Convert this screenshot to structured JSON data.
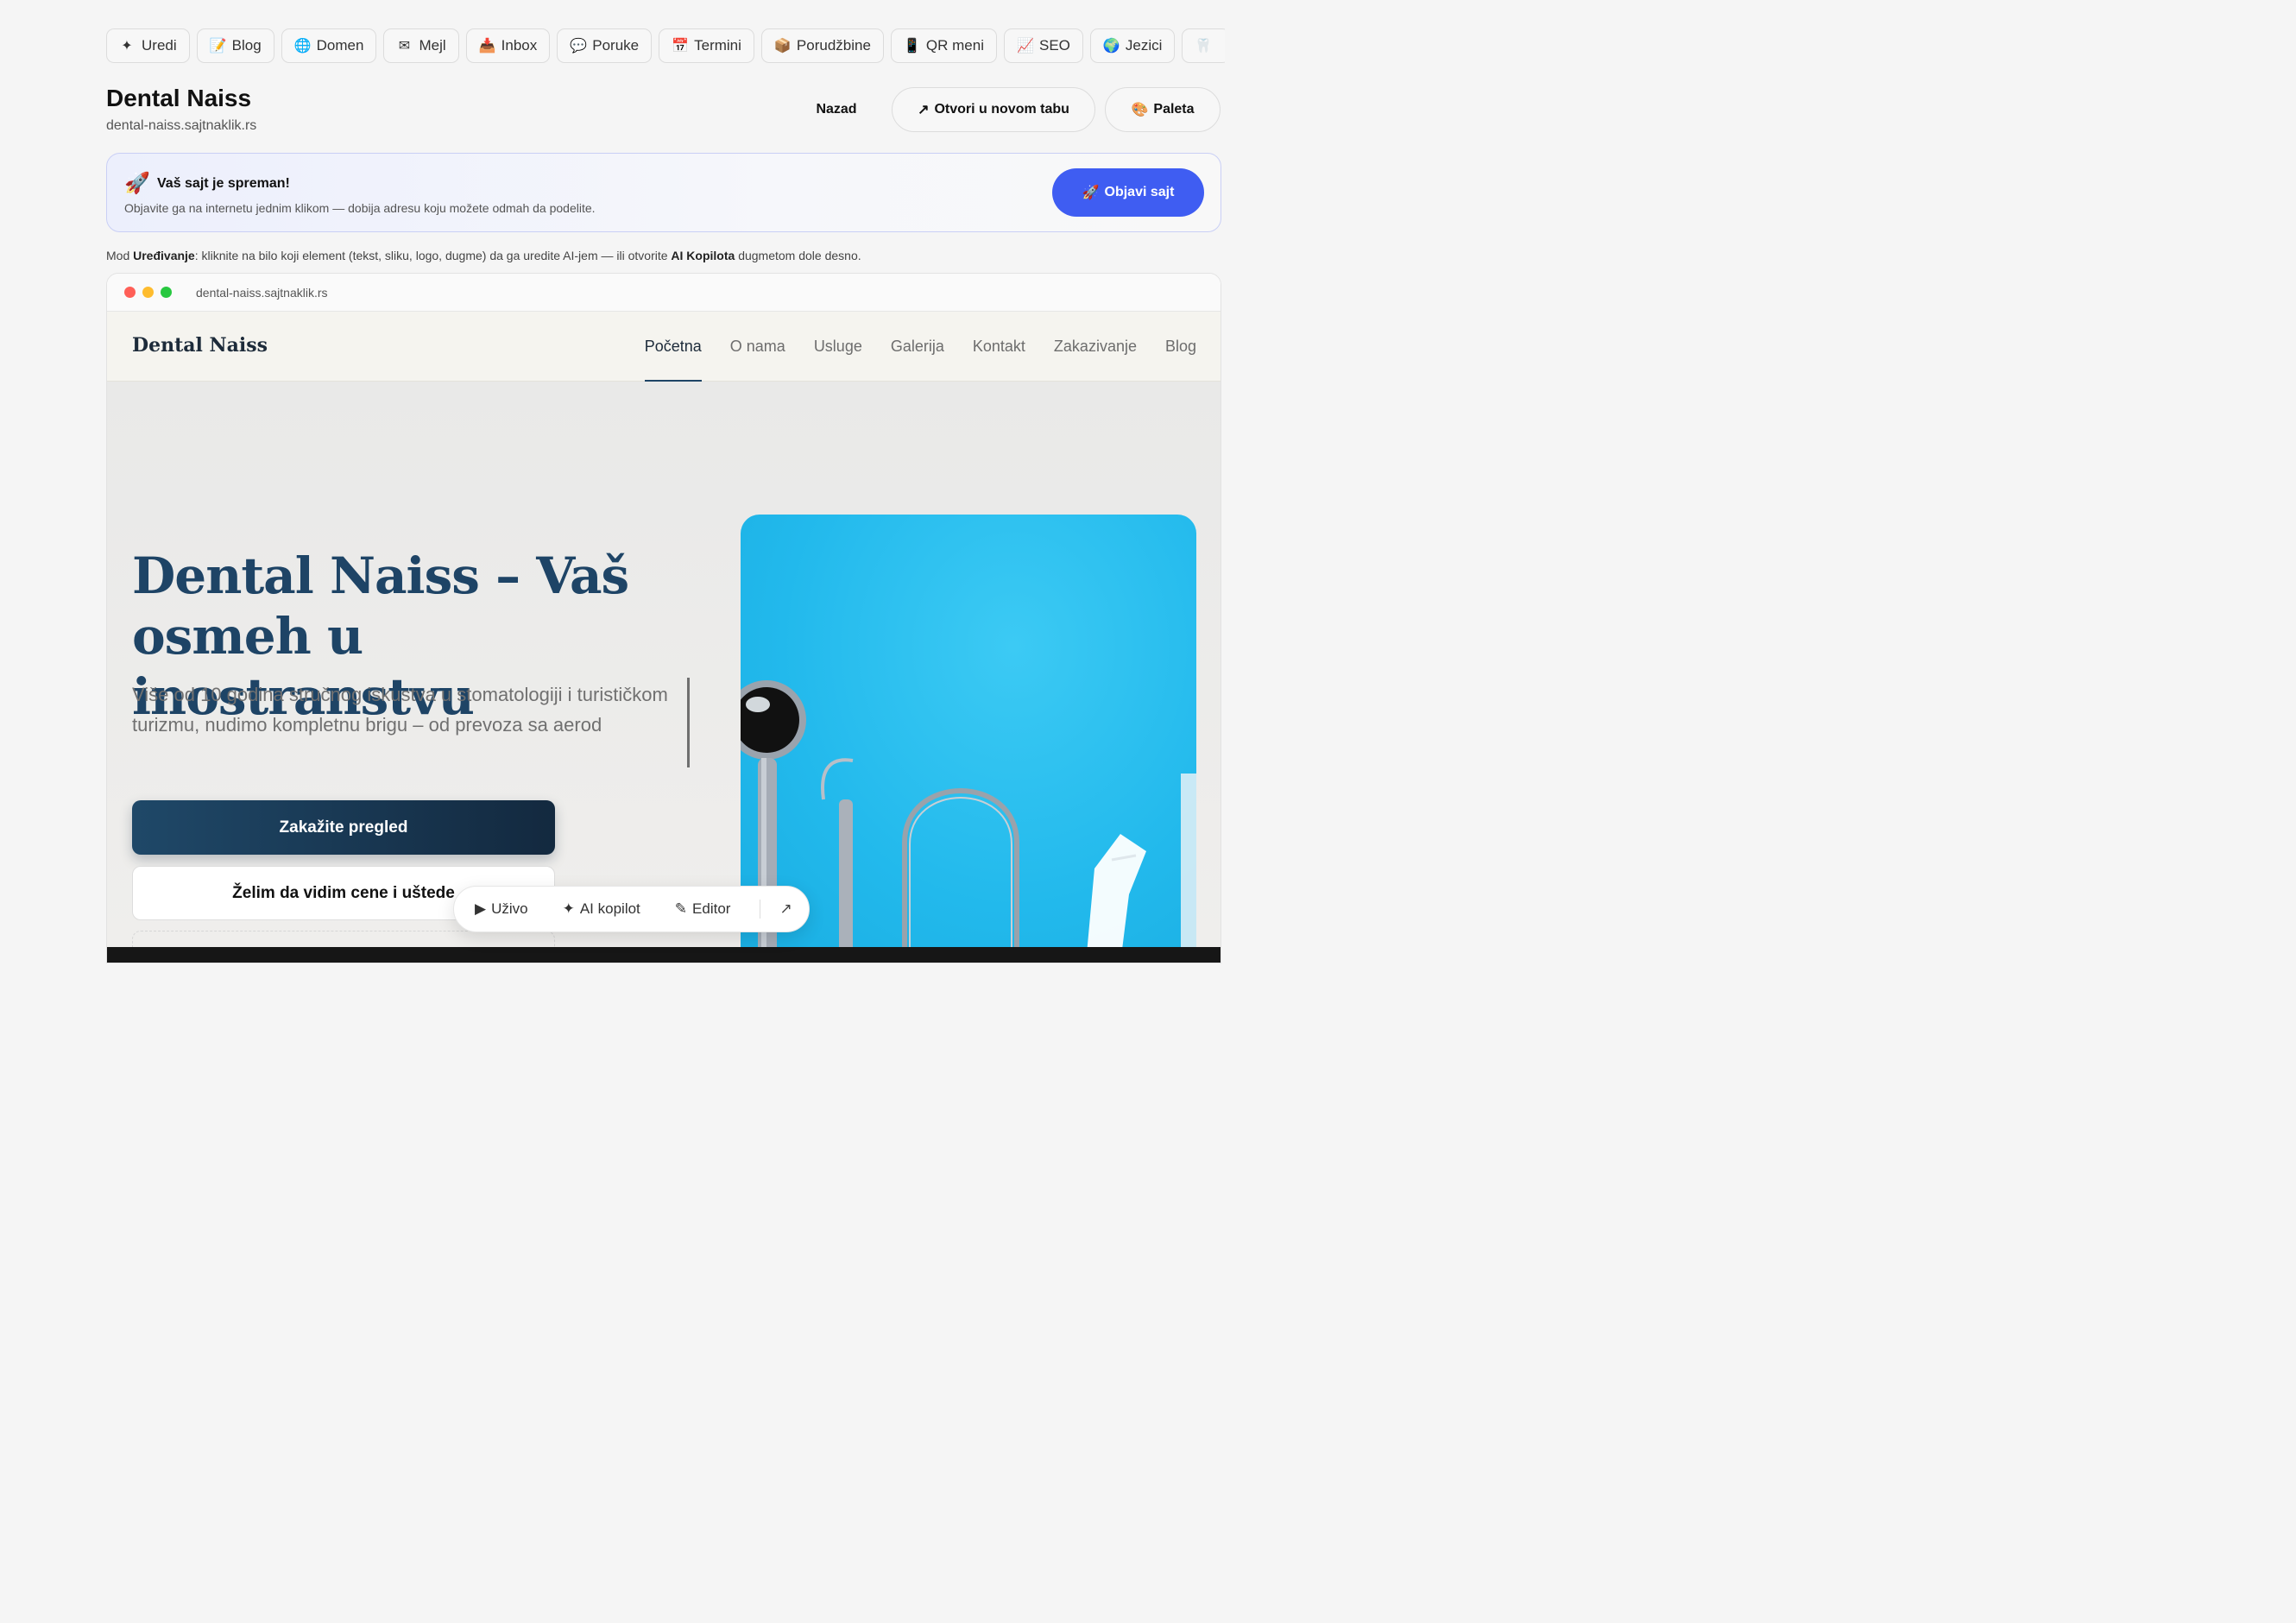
{
  "tabs": [
    {
      "icon": "✦",
      "icon_name": "sparkle-icon",
      "label": "Uredi"
    },
    {
      "icon": "📝",
      "icon_name": "memo-icon",
      "label": "Blog"
    },
    {
      "icon": "🌐",
      "icon_name": "globe-icon",
      "label": "Domen"
    },
    {
      "icon": "✉",
      "icon_name": "mail-icon",
      "label": "Mejl"
    },
    {
      "icon": "📥",
      "icon_name": "inbox-tray-icon",
      "label": "Inbox"
    },
    {
      "icon": "💬",
      "icon_name": "speech-bubble-icon",
      "label": "Poruke"
    },
    {
      "icon": "📅",
      "icon_name": "calendar-icon",
      "label": "Termini"
    },
    {
      "icon": "📦",
      "icon_name": "package-icon",
      "label": "Porudžbine"
    },
    {
      "icon": "📱",
      "icon_name": "mobile-phone-icon",
      "label": "QR meni"
    },
    {
      "icon": "📈",
      "icon_name": "chart-increasing-icon",
      "label": "SEO"
    },
    {
      "icon": "🌍",
      "icon_name": "globe-earth-icon",
      "label": "Jezici"
    },
    {
      "icon": "🦷",
      "icon_name": "tooth-icon",
      "label": ""
    }
  ],
  "header": {
    "title": "Dental Naiss",
    "url": "dental-naiss.sajtnaklik.rs",
    "back_label": "Nazad",
    "open_new_tab_icon": "↗",
    "open_new_tab_label": "Otvori u novom tabu",
    "palette_icon": "🎨",
    "palette_label": "Paleta"
  },
  "banner": {
    "icon": "🚀",
    "title": "Vaš sajt je spreman!",
    "subtitle": "Objavite ga na internetu jednim klikom — dobija adresu koju možete odmah da podelite.",
    "publish_icon": "🚀",
    "publish_label": "Objavi sajt",
    "accent": "#3f5df2"
  },
  "hint": {
    "prefix": "Mod ",
    "mode": "Uređivanje",
    "middle": ": kliknite na bilo koji element (tekst, sliku, logo, dugme) da ga uredite AI-jem — ili otvorite ",
    "copilot": "AI Kopilota",
    "suffix": " dugmetom dole desno."
  },
  "browser": {
    "url": "dental-naiss.sajtnaklik.rs",
    "dots": [
      "#ff5f57",
      "#febc2e",
      "#28c840"
    ]
  },
  "site": {
    "brand": "Dental Naiss",
    "menu": [
      "Početna",
      "O nama",
      "Usluge",
      "Galerija",
      "Kontakt",
      "Zakazivanje",
      "Blog"
    ],
    "active_menu": "Početna",
    "hero_title": "Dental Naiss – Vaš osmeh u inostranstvu",
    "hero_subtitle": "Više od 10 godina stručnog iskustva u stomatologiji i turističkom turizmu, nudimo kompletnu brigu – od prevoza sa aerod",
    "cta_primary": "Zakažite pregled",
    "cta_secondary": "Želim da vidim cene i uštede",
    "primary_color": "#1e4466",
    "hero_image_color": "#22b9ec"
  },
  "floatbar": {
    "live_icon": "▶",
    "live_label": "Uživo",
    "copilot_icon": "✦",
    "copilot_label": "AI kopilot",
    "editor_icon": "✎",
    "editor_label": "Editor",
    "expand_icon": "↗"
  }
}
